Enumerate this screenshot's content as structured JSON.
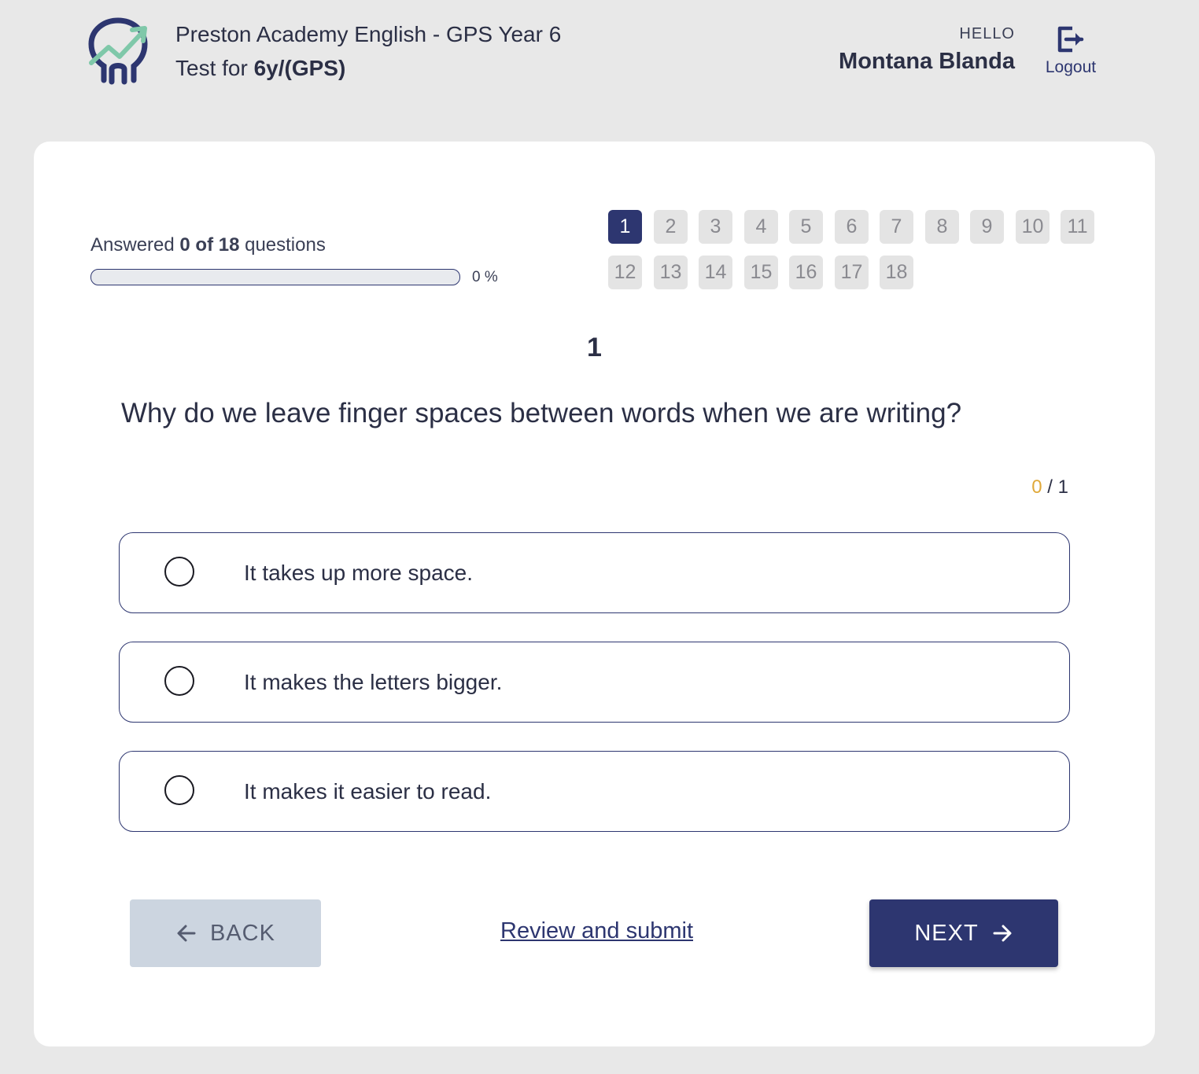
{
  "header": {
    "course_title": "Preston Academy English - GPS Year 6",
    "test_prefix": "Test for ",
    "test_name": "6y/(GPS)",
    "greeting": "HELLO",
    "user_name": "Montana Blanda",
    "logout_label": "Logout",
    "logo_icon": "logo-growth-icon",
    "logout_icon": "logout-icon"
  },
  "progress": {
    "answered_prefix": "Answered ",
    "answered_count": "0 of 18",
    "answered_suffix": " questions",
    "percent_label": "0 %",
    "fraction": 0
  },
  "question_nav": {
    "current": "1",
    "items": [
      "1",
      "2",
      "3",
      "4",
      "5",
      "6",
      "7",
      "8",
      "9",
      "10",
      "11",
      "12",
      "13",
      "14",
      "15",
      "16",
      "17",
      "18"
    ]
  },
  "question": {
    "number": "1",
    "text": "Why do we leave finger spaces between words when we are writing?",
    "score_got": "0",
    "score_sep": " / ",
    "score_total": "1",
    "options": [
      "It takes up more space.",
      "It makes the letters bigger.",
      "It makes it easier to read."
    ]
  },
  "footer": {
    "back_label": "BACK",
    "review_label": "Review and submit",
    "next_label": "NEXT"
  },
  "colors": {
    "primary": "#2d3670",
    "accent": "#e0a93a",
    "logo_green": "#7fc8a9",
    "back_bg": "#ccd5e0"
  }
}
